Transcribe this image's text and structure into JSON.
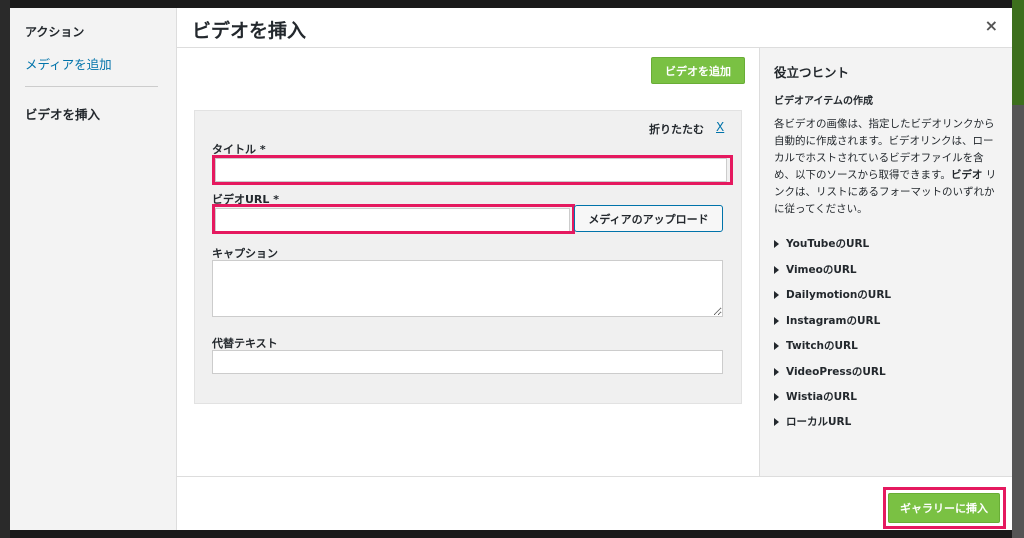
{
  "menu": {
    "heading": "アクション",
    "add_media": "メディアを追加",
    "insert_video": "ビデオを挿入"
  },
  "modal": {
    "title": "ビデオを挿入",
    "close": "×"
  },
  "content": {
    "add_video_button": "ビデオを追加",
    "collapse_label": "折りたたむ",
    "collapse_x": "X",
    "fields": {
      "title_label": "タイトル *",
      "title_value": "",
      "url_label": "ビデオURL *",
      "url_value": "",
      "upload_button": "メディアのアップロード",
      "caption_label": "キャプション",
      "caption_value": "",
      "alt_label": "代替テキスト",
      "alt_value": ""
    }
  },
  "sidebar": {
    "title": "役立つヒント",
    "subtitle": "ビデオアイテムの作成",
    "description_before": "各ビデオの画像は、指定したビデオリンクから自動的に作成されます。ビデオリンクは、ローカルでホストされているビデオファイルを含め、以下のソースから取得できます。",
    "description_bold": "ビデオ",
    "description_after": " リンクは、リストにあるフォーマットのいずれかに従ってください。",
    "sources": [
      "YouTubeのURL",
      "VimeoのURL",
      "DailymotionのURL",
      "InstagramのURL",
      "TwitchのURL",
      "VideoPressのURL",
      "WistiaのURL",
      "ローカルURL"
    ]
  },
  "footer": {
    "insert_button": "ギャラリーに挿入"
  },
  "colors": {
    "accent_green": "#7ac143",
    "highlight": "#e5195f",
    "link_blue": "#0073aa"
  }
}
